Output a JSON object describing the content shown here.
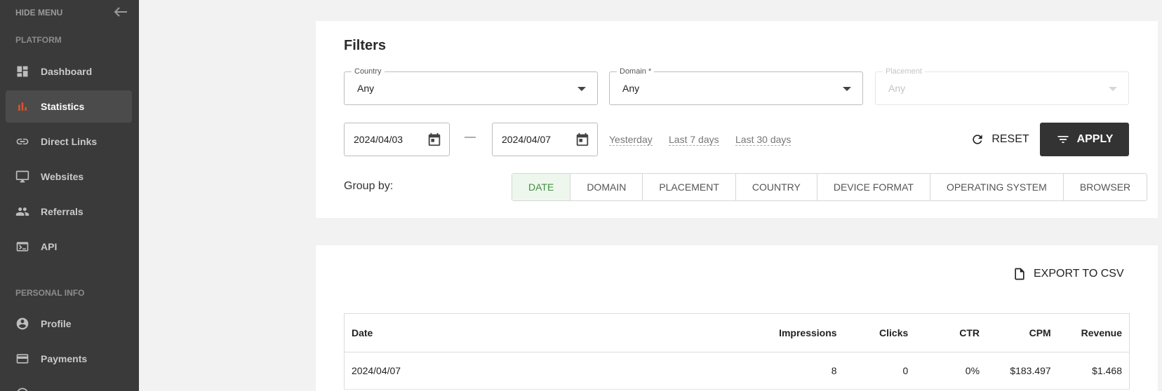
{
  "sidebar": {
    "hide_menu": "HIDE MENU",
    "platform_title": "PLATFORM",
    "personal_title": "PERSONAL INFO",
    "items": [
      {
        "label": "Dashboard",
        "icon": "dashboard-icon"
      },
      {
        "label": "Statistics",
        "icon": "bar-chart-icon",
        "active": true
      },
      {
        "label": "Direct Links",
        "icon": "link-icon"
      },
      {
        "label": "Websites",
        "icon": "monitor-icon"
      },
      {
        "label": "Referrals",
        "icon": "people-icon"
      },
      {
        "label": "API",
        "icon": "terminal-icon"
      }
    ],
    "personal_items": [
      {
        "label": "Profile",
        "icon": "account-circle-icon"
      },
      {
        "label": "Payments",
        "icon": "credit-card-icon"
      }
    ]
  },
  "filters": {
    "title": "Filters",
    "country": {
      "label": "Country",
      "value": "Any"
    },
    "domain": {
      "label": "Domain *",
      "value": "Any"
    },
    "placement": {
      "label": "Placement",
      "value": "Any"
    },
    "date_from": "2024/04/03",
    "date_separator": "—",
    "date_to": "2024/04/07",
    "quick_ranges": [
      "Yesterday",
      "Last 7 days",
      "Last 30 days"
    ],
    "reset_label": "RESET",
    "apply_label": "APPLY",
    "group_by_label": "Group by:",
    "group_by_options": [
      "DATE",
      "DOMAIN",
      "PLACEMENT",
      "COUNTRY",
      "DEVICE FORMAT",
      "OPERATING SYSTEM",
      "BROWSER"
    ],
    "group_by_selected": "DATE"
  },
  "results": {
    "export_label": "EXPORT TO CSV",
    "columns": [
      "Date",
      "Impressions",
      "Clicks",
      "CTR",
      "CPM",
      "Revenue"
    ],
    "rows": [
      [
        "2024/04/07",
        "8",
        "0",
        "0%",
        "$183.497",
        "$1.468"
      ]
    ]
  },
  "colors": {
    "sidebar_bg": "#3a3a3a",
    "accent": "#e0542b",
    "apply_bg": "#333333",
    "group_active": "#3f8e3f"
  }
}
